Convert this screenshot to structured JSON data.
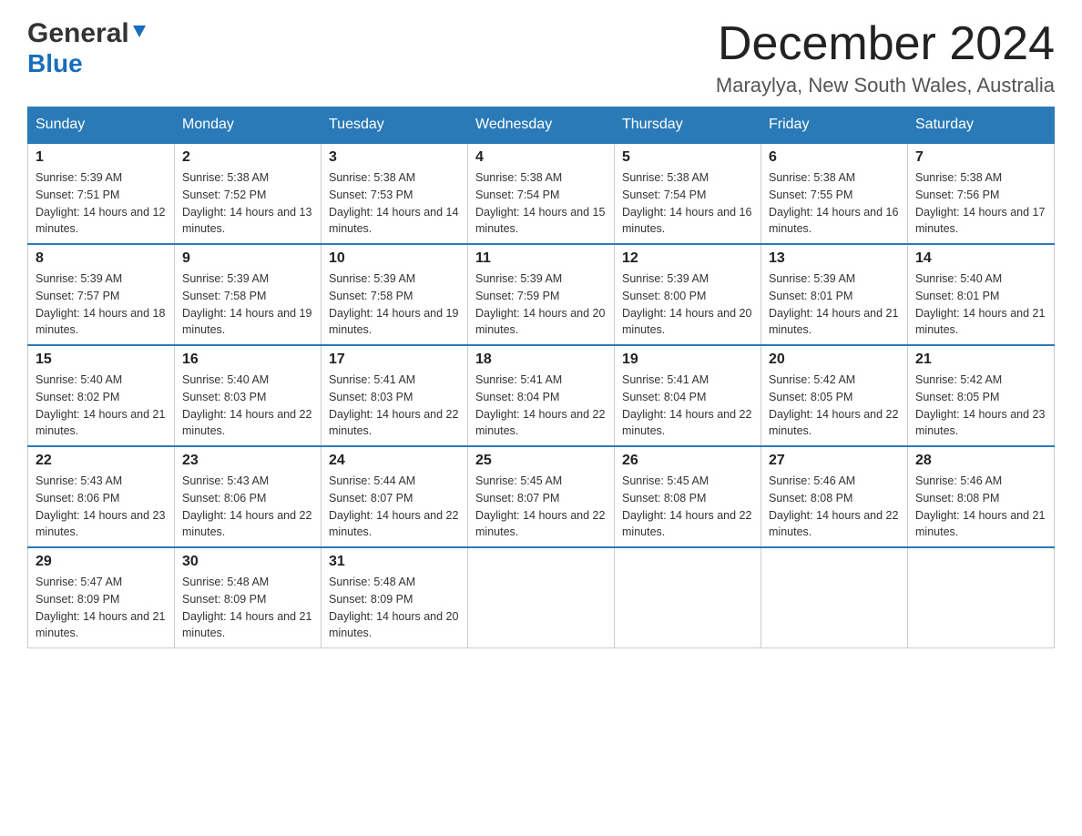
{
  "header": {
    "logo_general": "General",
    "logo_blue": "Blue",
    "title": "December 2024",
    "subtitle": "Maraylya, New South Wales, Australia"
  },
  "calendar": {
    "days": [
      "Sunday",
      "Monday",
      "Tuesday",
      "Wednesday",
      "Thursday",
      "Friday",
      "Saturday"
    ],
    "weeks": [
      [
        {
          "date": "1",
          "sunrise": "5:39 AM",
          "sunset": "7:51 PM",
          "daylight": "14 hours and 12 minutes."
        },
        {
          "date": "2",
          "sunrise": "5:38 AM",
          "sunset": "7:52 PM",
          "daylight": "14 hours and 13 minutes."
        },
        {
          "date": "3",
          "sunrise": "5:38 AM",
          "sunset": "7:53 PM",
          "daylight": "14 hours and 14 minutes."
        },
        {
          "date": "4",
          "sunrise": "5:38 AM",
          "sunset": "7:54 PM",
          "daylight": "14 hours and 15 minutes."
        },
        {
          "date": "5",
          "sunrise": "5:38 AM",
          "sunset": "7:54 PM",
          "daylight": "14 hours and 16 minutes."
        },
        {
          "date": "6",
          "sunrise": "5:38 AM",
          "sunset": "7:55 PM",
          "daylight": "14 hours and 16 minutes."
        },
        {
          "date": "7",
          "sunrise": "5:38 AM",
          "sunset": "7:56 PM",
          "daylight": "14 hours and 17 minutes."
        }
      ],
      [
        {
          "date": "8",
          "sunrise": "5:39 AM",
          "sunset": "7:57 PM",
          "daylight": "14 hours and 18 minutes."
        },
        {
          "date": "9",
          "sunrise": "5:39 AM",
          "sunset": "7:58 PM",
          "daylight": "14 hours and 19 minutes."
        },
        {
          "date": "10",
          "sunrise": "5:39 AM",
          "sunset": "7:58 PM",
          "daylight": "14 hours and 19 minutes."
        },
        {
          "date": "11",
          "sunrise": "5:39 AM",
          "sunset": "7:59 PM",
          "daylight": "14 hours and 20 minutes."
        },
        {
          "date": "12",
          "sunrise": "5:39 AM",
          "sunset": "8:00 PM",
          "daylight": "14 hours and 20 minutes."
        },
        {
          "date": "13",
          "sunrise": "5:39 AM",
          "sunset": "8:01 PM",
          "daylight": "14 hours and 21 minutes."
        },
        {
          "date": "14",
          "sunrise": "5:40 AM",
          "sunset": "8:01 PM",
          "daylight": "14 hours and 21 minutes."
        }
      ],
      [
        {
          "date": "15",
          "sunrise": "5:40 AM",
          "sunset": "8:02 PM",
          "daylight": "14 hours and 21 minutes."
        },
        {
          "date": "16",
          "sunrise": "5:40 AM",
          "sunset": "8:03 PM",
          "daylight": "14 hours and 22 minutes."
        },
        {
          "date": "17",
          "sunrise": "5:41 AM",
          "sunset": "8:03 PM",
          "daylight": "14 hours and 22 minutes."
        },
        {
          "date": "18",
          "sunrise": "5:41 AM",
          "sunset": "8:04 PM",
          "daylight": "14 hours and 22 minutes."
        },
        {
          "date": "19",
          "sunrise": "5:41 AM",
          "sunset": "8:04 PM",
          "daylight": "14 hours and 22 minutes."
        },
        {
          "date": "20",
          "sunrise": "5:42 AM",
          "sunset": "8:05 PM",
          "daylight": "14 hours and 22 minutes."
        },
        {
          "date": "21",
          "sunrise": "5:42 AM",
          "sunset": "8:05 PM",
          "daylight": "14 hours and 23 minutes."
        }
      ],
      [
        {
          "date": "22",
          "sunrise": "5:43 AM",
          "sunset": "8:06 PM",
          "daylight": "14 hours and 23 minutes."
        },
        {
          "date": "23",
          "sunrise": "5:43 AM",
          "sunset": "8:06 PM",
          "daylight": "14 hours and 22 minutes."
        },
        {
          "date": "24",
          "sunrise": "5:44 AM",
          "sunset": "8:07 PM",
          "daylight": "14 hours and 22 minutes."
        },
        {
          "date": "25",
          "sunrise": "5:45 AM",
          "sunset": "8:07 PM",
          "daylight": "14 hours and 22 minutes."
        },
        {
          "date": "26",
          "sunrise": "5:45 AM",
          "sunset": "8:08 PM",
          "daylight": "14 hours and 22 minutes."
        },
        {
          "date": "27",
          "sunrise": "5:46 AM",
          "sunset": "8:08 PM",
          "daylight": "14 hours and 22 minutes."
        },
        {
          "date": "28",
          "sunrise": "5:46 AM",
          "sunset": "8:08 PM",
          "daylight": "14 hours and 21 minutes."
        }
      ],
      [
        {
          "date": "29",
          "sunrise": "5:47 AM",
          "sunset": "8:09 PM",
          "daylight": "14 hours and 21 minutes."
        },
        {
          "date": "30",
          "sunrise": "5:48 AM",
          "sunset": "8:09 PM",
          "daylight": "14 hours and 21 minutes."
        },
        {
          "date": "31",
          "sunrise": "5:48 AM",
          "sunset": "8:09 PM",
          "daylight": "14 hours and 20 minutes."
        },
        null,
        null,
        null,
        null
      ]
    ]
  }
}
